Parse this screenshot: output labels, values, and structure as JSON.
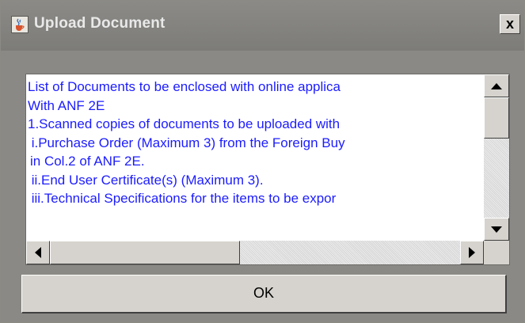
{
  "window": {
    "title": "Upload Document",
    "close_label": "x"
  },
  "document_text": {
    "lines": [
      "List of Documents to be enclosed with online applica",
      "With ANF 2E",
      "1.Scanned copies of documents to be uploaded with",
      " i.Purchase Order (Maximum 3) from the Foreign Buy",
      "in Col.2 of ANF 2E.",
      " ii.End User Certificate(s) (Maximum 3).",
      " iii.Technical Specifications for the items to be expor"
    ]
  },
  "buttons": {
    "ok_label": "OK"
  },
  "colors": {
    "text": "#1c1cff",
    "title_bar": "#85847f",
    "dialog_bg": "#d6d3ce"
  },
  "icons": {
    "app": "java-cup-icon",
    "scroll_up": "arrow-up-icon",
    "scroll_down": "arrow-down-icon",
    "scroll_left": "arrow-left-icon",
    "scroll_right": "arrow-right-icon"
  }
}
